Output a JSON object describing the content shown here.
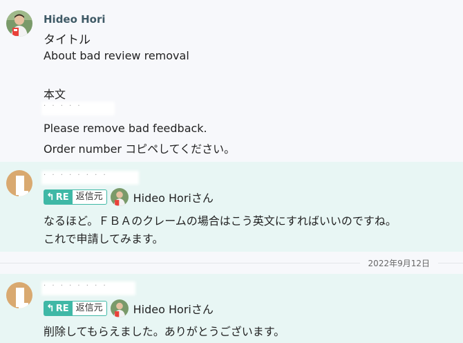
{
  "messages": {
    "first": {
      "sender": "Hideo Hori",
      "lines": [
        "タイトル",
        "About bad review removal",
        "本文",
        "Please remove bad feedback.",
        "Order number  コピペしてください。"
      ]
    },
    "second": {
      "reply_badge": "RE",
      "reply_label": "返信元",
      "reply_to": "Hideo Horiさん",
      "lines": [
        "なるほど。ＦＢＡのクレームの場合はこう英文にすればいいのですね。",
        "これで申請してみます。"
      ]
    },
    "third": {
      "reply_badge": "RE",
      "reply_label": "返信元",
      "reply_to": "Hideo Horiさん",
      "lines": [
        "削除してもらえました。ありがとうございます。"
      ]
    }
  },
  "date_separator": "2022年9月12日",
  "icons": {
    "reply": "reply-arrow-icon",
    "avatar": "person-avatar"
  },
  "colors": {
    "reply_bg": "#e8f6f4",
    "accent": "#3fb8a6",
    "sender": "#3f5a66"
  }
}
